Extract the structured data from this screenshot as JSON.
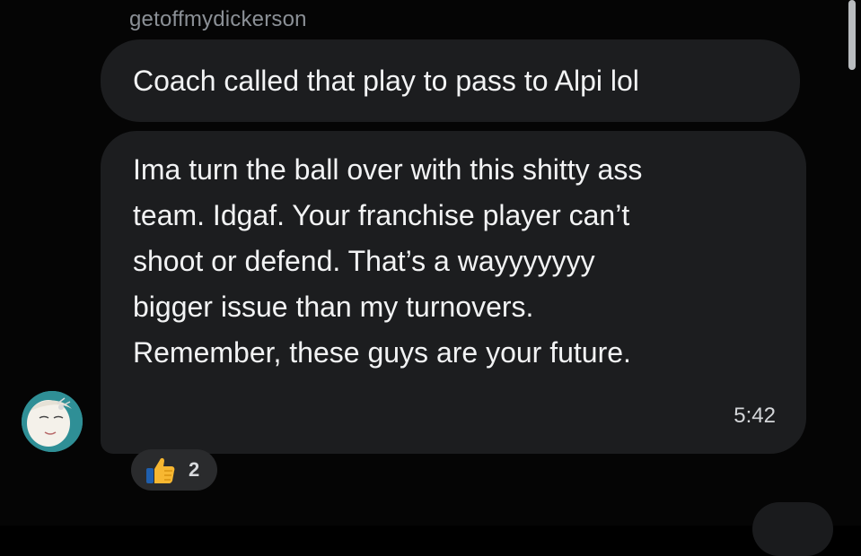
{
  "conversation": {
    "sender_name": "getoffmydickerson",
    "messages": [
      {
        "text": "Coach called that play to pass to Alpi lol"
      },
      {
        "lines": [
          "Ima turn the ball over with this shitty ass",
          "team. Idgaf. Your franchise player can’t",
          "shoot or defend. That’s a wayyyyyyy",
          "bigger issue than my turnovers.",
          "Remember, these guys are your future."
        ],
        "timestamp": "5:42",
        "reaction": {
          "icon": "thumbs-up-icon",
          "count": "2"
        }
      }
    ]
  },
  "colors": {
    "background": "#050505",
    "bubble": "#1c1d1f",
    "sender_text": "#8b9096",
    "message_text": "#f2f3f4",
    "reaction_pill": "#2a2b2d",
    "avatar_teal": "#2f8f96"
  }
}
